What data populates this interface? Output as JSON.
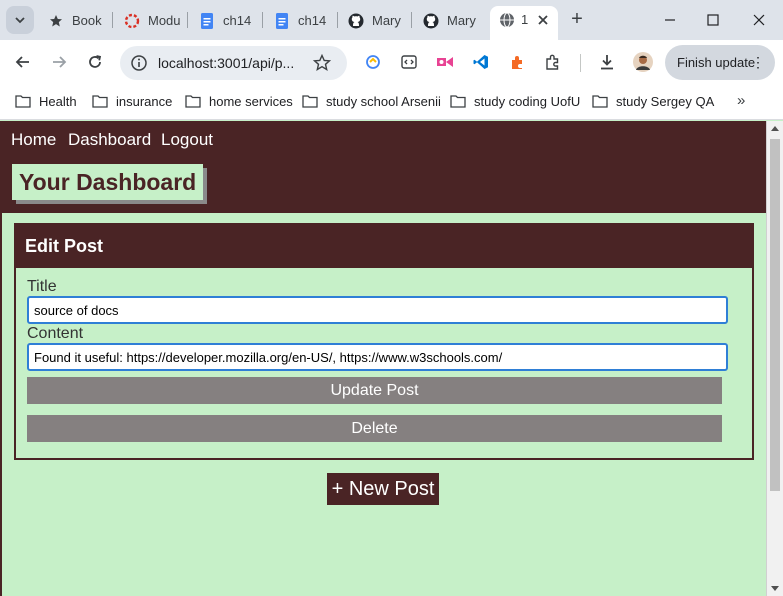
{
  "browser": {
    "tabs": [
      {
        "label": "Book",
        "icon": "star-icon"
      },
      {
        "label": "Modu",
        "icon": "module-icon"
      },
      {
        "label": "ch14",
        "icon": "docs-icon"
      },
      {
        "label": "ch14",
        "icon": "docs-icon"
      },
      {
        "label": "Mary",
        "icon": "github-icon"
      },
      {
        "label": "Mary",
        "icon": "github-icon"
      },
      {
        "label": "1",
        "icon": "globe-icon"
      }
    ],
    "url": "localhost:3001/api/p...",
    "finish_update_label": "Finish update",
    "bookmarks": [
      "Health",
      "insurance",
      "home services",
      "study school Arsenii",
      "study coding UofU",
      "study Sergey QA"
    ]
  },
  "site": {
    "nav": {
      "home": "Home",
      "dashboard": "Dashboard",
      "logout": "Logout"
    },
    "dashboard_title": "Your Dashboard"
  },
  "edit_post": {
    "header": "Edit Post",
    "title_label": "Title",
    "title_value": "source of docs",
    "content_label": "Content",
    "content_value": "Found it useful: https://developer.mozilla.org/en-US/, https://www.w3schools.com/",
    "update_label": "Update Post",
    "delete_label": "Delete"
  },
  "new_post_label": "+ New Post",
  "colors": {
    "brand": "#4a2425",
    "background": "#c6f0c8",
    "button_gray": "#858080",
    "input_focus": "#2f7fd6"
  }
}
